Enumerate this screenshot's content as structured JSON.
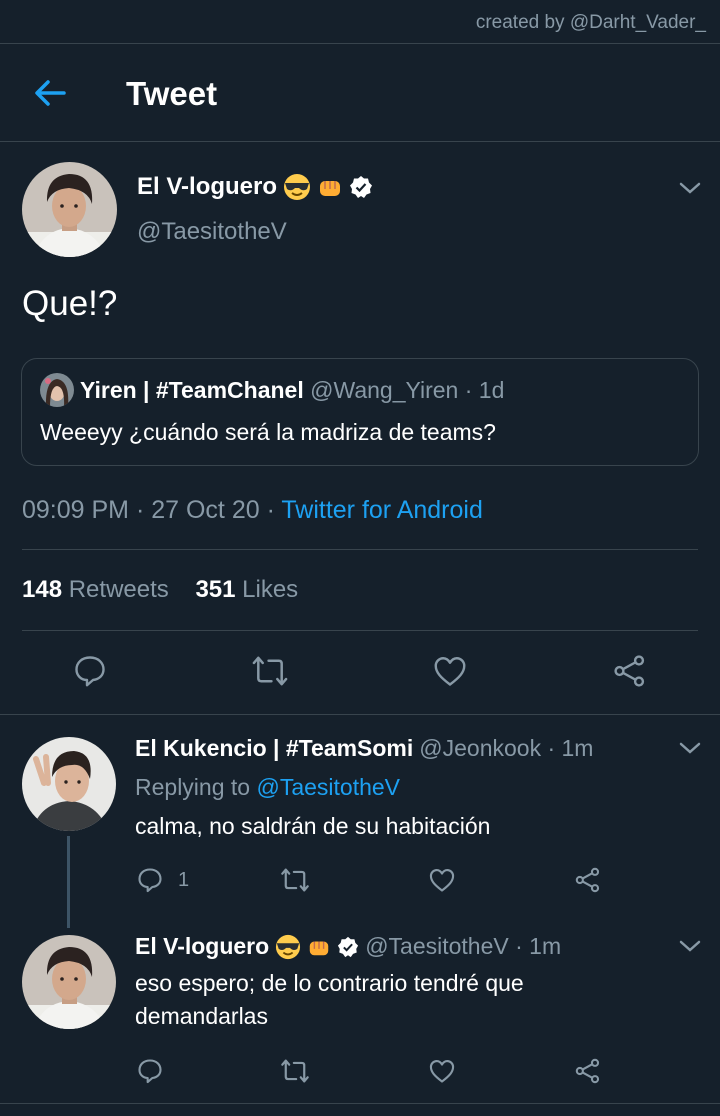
{
  "credit": "created by @Darht_Vader_",
  "header": {
    "title": "Tweet"
  },
  "main_tweet": {
    "name": "El V-loguero",
    "handle": "@TaesitotheV",
    "text": "Que!?",
    "quote": {
      "name": "Yiren | #TeamChanel",
      "handle_time": "@Wang_Yiren · 1d",
      "text": "Weeeyy ¿cuándo será la madriza de teams?"
    },
    "time": "09:09 PM · 27 Oct 20 · ",
    "source": "Twitter for Android",
    "retweets": "148",
    "retweets_label": "Retweets",
    "likes": "351",
    "likes_label": "Likes"
  },
  "replies": [
    {
      "name": "El Kukencio | #TeamSomi",
      "handle_time": "@Jeonkook · 1m",
      "replying_prefix": "Replying to ",
      "replying_to": "@TaesitotheV",
      "text": "calma, no saldrán de su habitación",
      "reply_count": "1"
    },
    {
      "name": "El V-loguero",
      "handle_time": "@TaesitotheV · 1m",
      "text_line1": "eso espero; de lo contrario tendré que",
      "text_line2": "demandarlas"
    }
  ],
  "colors": {
    "background": "#15202b",
    "accent": "#1da1f2",
    "muted": "#8899a6",
    "divider": "#38444d"
  }
}
